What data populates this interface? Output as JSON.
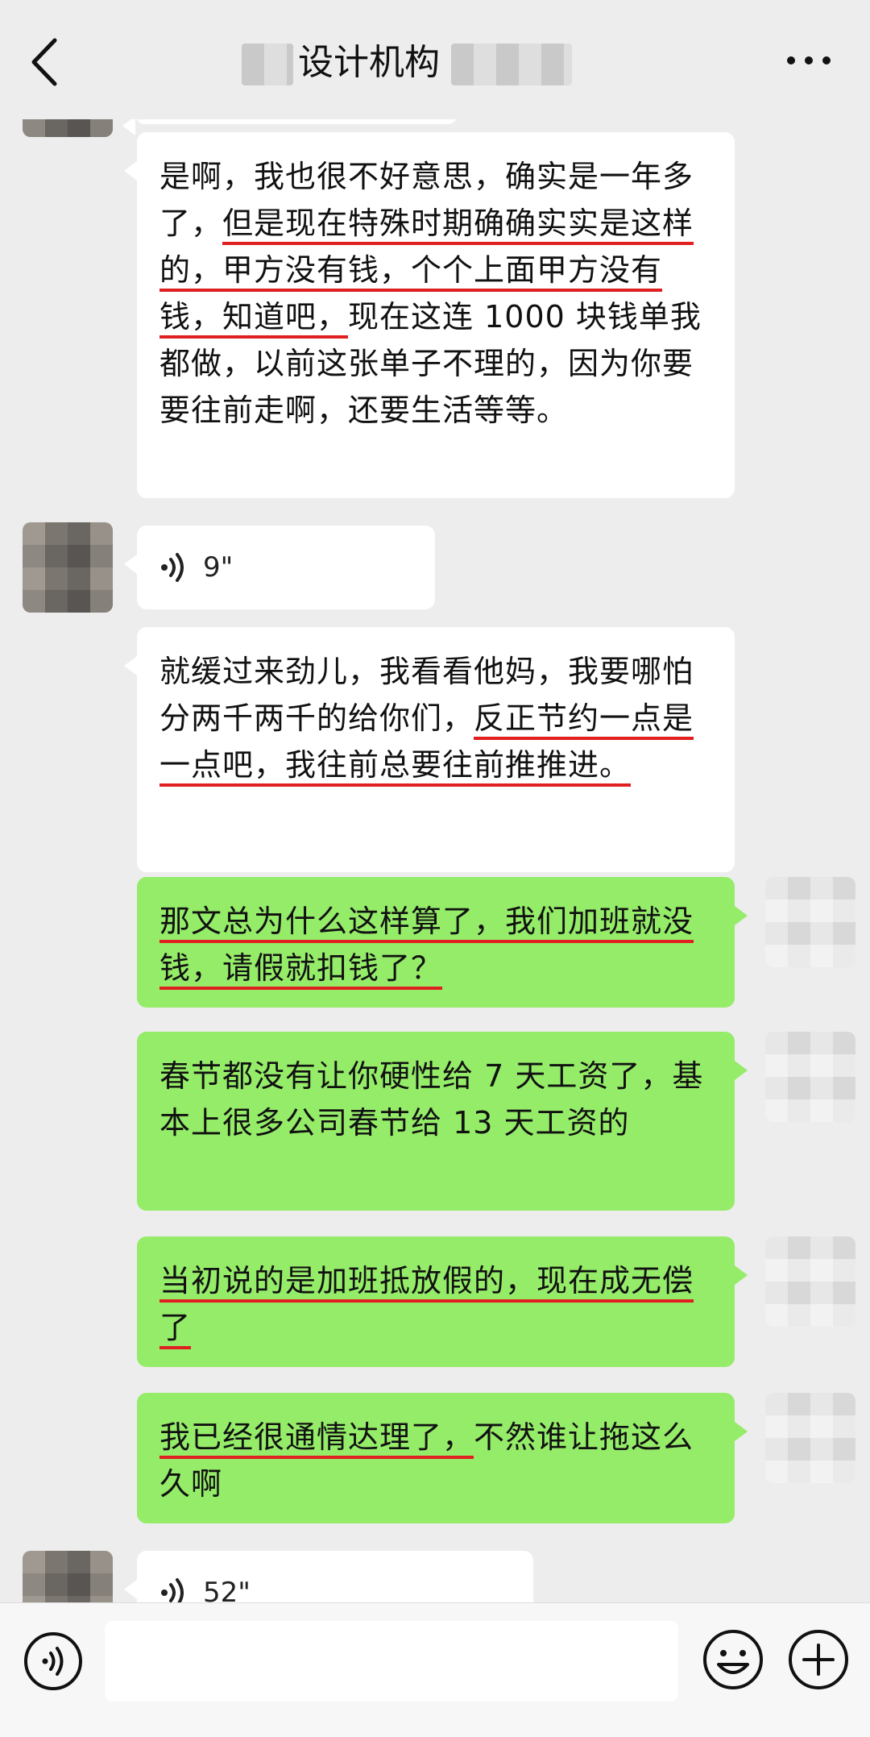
{
  "header": {
    "title": "设计机构",
    "back_icon": "back-chevron-icon",
    "more_icon": "more-dots-icon"
  },
  "messages": [
    {
      "type": "text",
      "side": "left",
      "segments": [
        {
          "t": "是啊，我也很不好意思，确实是一年多了，",
          "u": false
        },
        {
          "t": "但是现在特殊时期确确实实是这样的，甲方没有钱，个个上面甲方没有钱，知道吧，",
          "u": true
        },
        {
          "t": "现在这连 1000 块钱单我都做，以前这张单子不理的，因为你要要往前走啊，还要生活等等。",
          "u": false
        }
      ]
    },
    {
      "type": "voice",
      "side": "left",
      "duration": "9\""
    },
    {
      "type": "text",
      "side": "left",
      "segments": [
        {
          "t": "就缓过来劲儿，我看看他妈，我要哪怕分两千两千的给你们，",
          "u": false
        },
        {
          "t": "反正节约一点是一点吧，我往前总要往前推推进。",
          "u": true
        }
      ]
    },
    {
      "type": "text",
      "side": "right",
      "segments": [
        {
          "t": "那文总为什么这样算了，我们加班就没钱，请假就扣钱了？",
          "u": true
        }
      ]
    },
    {
      "type": "text",
      "side": "right",
      "segments": [
        {
          "t": "春节都没有让你硬性给 7 天工资了，基本上很多公司春节给 13 天工资的",
          "u": false
        }
      ]
    },
    {
      "type": "text",
      "side": "right",
      "segments": [
        {
          "t": "当初说的是加班抵放假的，现在成无偿了",
          "u": true
        }
      ]
    },
    {
      "type": "text",
      "side": "right",
      "segments": [
        {
          "t": "我已经很通情达理了，",
          "u": true
        },
        {
          "t": "不然谁让拖这么久啊",
          "u": false
        }
      ]
    },
    {
      "type": "voice",
      "side": "left",
      "duration": "52\""
    }
  ],
  "input": {
    "value": "",
    "voice_icon": "voice-mode-icon",
    "emoji_icon": "emoji-icon",
    "plus_icon": "plus-icon"
  },
  "colors": {
    "background": "#ededed",
    "green_bubble": "#95ec69",
    "white_bubble": "#ffffff",
    "underline": "#e02020"
  }
}
